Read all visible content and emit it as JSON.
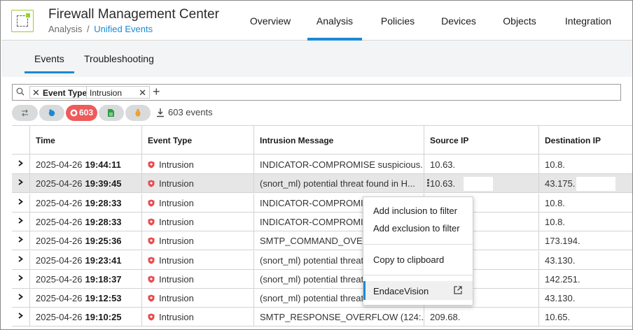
{
  "header": {
    "title": "Firewall Management Center",
    "breadcrumb_root": "Analysis",
    "breadcrumb_sep": "/",
    "breadcrumb_current": "Unified Events",
    "nav": [
      "Overview",
      "Analysis",
      "Policies",
      "Devices",
      "Objects",
      "Integration"
    ],
    "active_nav": "Analysis",
    "accent": "#1a8ad6"
  },
  "subtabs": [
    "Events",
    "Troubleshooting"
  ],
  "search": {
    "chip_key": "Event Type",
    "chip_value": "Intrusion",
    "remove_glyph": "✕",
    "add_glyph": "+"
  },
  "filters": {
    "intrusion_count": "603",
    "events_label": "603 events",
    "active_color": "#ef5a5a"
  },
  "table": {
    "columns": [
      "Time",
      "Event Type",
      "Intrusion Message",
      "Source IP",
      "Destination IP"
    ],
    "rows": [
      {
        "date": "2025-04-26",
        "time": "19:44:11",
        "type": "Intrusion",
        "msg": "INDICATOR-COMPROMISE suspicious...",
        "src": "10.63.",
        "dst": "10.8."
      },
      {
        "date": "2025-04-26",
        "time": "19:39:45",
        "type": "Intrusion",
        "msg": "(snort_ml) potential threat found in H...",
        "src": "10.63.",
        "dst": "43.175."
      },
      {
        "date": "2025-04-26",
        "time": "19:28:33",
        "type": "Intrusion",
        "msg": "INDICATOR-COMPROMIS",
        "src": "",
        "dst": "10.8."
      },
      {
        "date": "2025-04-26",
        "time": "19:28:33",
        "type": "Intrusion",
        "msg": "INDICATOR-COMPROMIS",
        "src": "",
        "dst": "10.8."
      },
      {
        "date": "2025-04-26",
        "time": "19:25:36",
        "type": "Intrusion",
        "msg": "SMTP_COMMAND_OVER",
        "src": "",
        "dst": "173.194."
      },
      {
        "date": "2025-04-26",
        "time": "19:23:41",
        "type": "Intrusion",
        "msg": "(snort_ml) potential threat",
        "src": "",
        "dst": "43.130."
      },
      {
        "date": "2025-04-26",
        "time": "19:18:37",
        "type": "Intrusion",
        "msg": "(snort_ml) potential threat",
        "src": "",
        "dst": "142.251."
      },
      {
        "date": "2025-04-26",
        "time": "19:12:53",
        "type": "Intrusion",
        "msg": "(snort_ml) potential threat",
        "src": "",
        "dst": "43.130."
      },
      {
        "date": "2025-04-26",
        "time": "19:10:25",
        "type": "Intrusion",
        "msg": "SMTP_RESPONSE_OVERFLOW (124:...",
        "src": "209.68.",
        "dst": "10.65."
      }
    ],
    "highlight_row": 1
  },
  "context_menu": {
    "items": [
      "Add inclusion to filter",
      "Add exclusion to filter",
      "Copy to clipboard",
      "EndaceVision"
    ]
  }
}
